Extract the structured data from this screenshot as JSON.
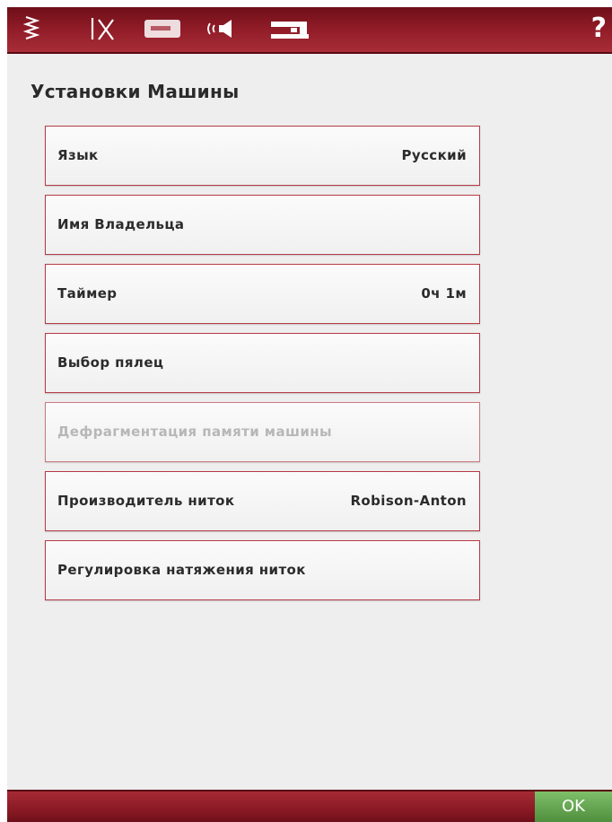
{
  "topbar": {
    "icons": [
      "stitch-zigzag-icon",
      "scissors-needle-icon",
      "embroidery-card-icon",
      "sound-speaker-icon",
      "sewing-machine-icon"
    ],
    "help_label": "?"
  },
  "page": {
    "title": "Установки Машины"
  },
  "settings": {
    "items": [
      {
        "label": "Язык",
        "value": "Русский"
      },
      {
        "label": "Имя Владельца",
        "value": ""
      },
      {
        "label": "Таймер",
        "value": "0ч 1м"
      },
      {
        "label": "Выбор пялец",
        "value": ""
      },
      {
        "label": "Дефрагментация памяти машины",
        "value": "",
        "disabled": true
      },
      {
        "label": "Производитель ниток",
        "value": "Robison-Anton"
      },
      {
        "label": "Регулировка натяжения ниток",
        "value": ""
      }
    ]
  },
  "footer": {
    "ok_label": "OK"
  },
  "colors": {
    "bar_dark": "#6e0f19",
    "bar_light": "#a82d38",
    "row_border": "#b53a45",
    "ok_green": "#5f9f4a"
  }
}
